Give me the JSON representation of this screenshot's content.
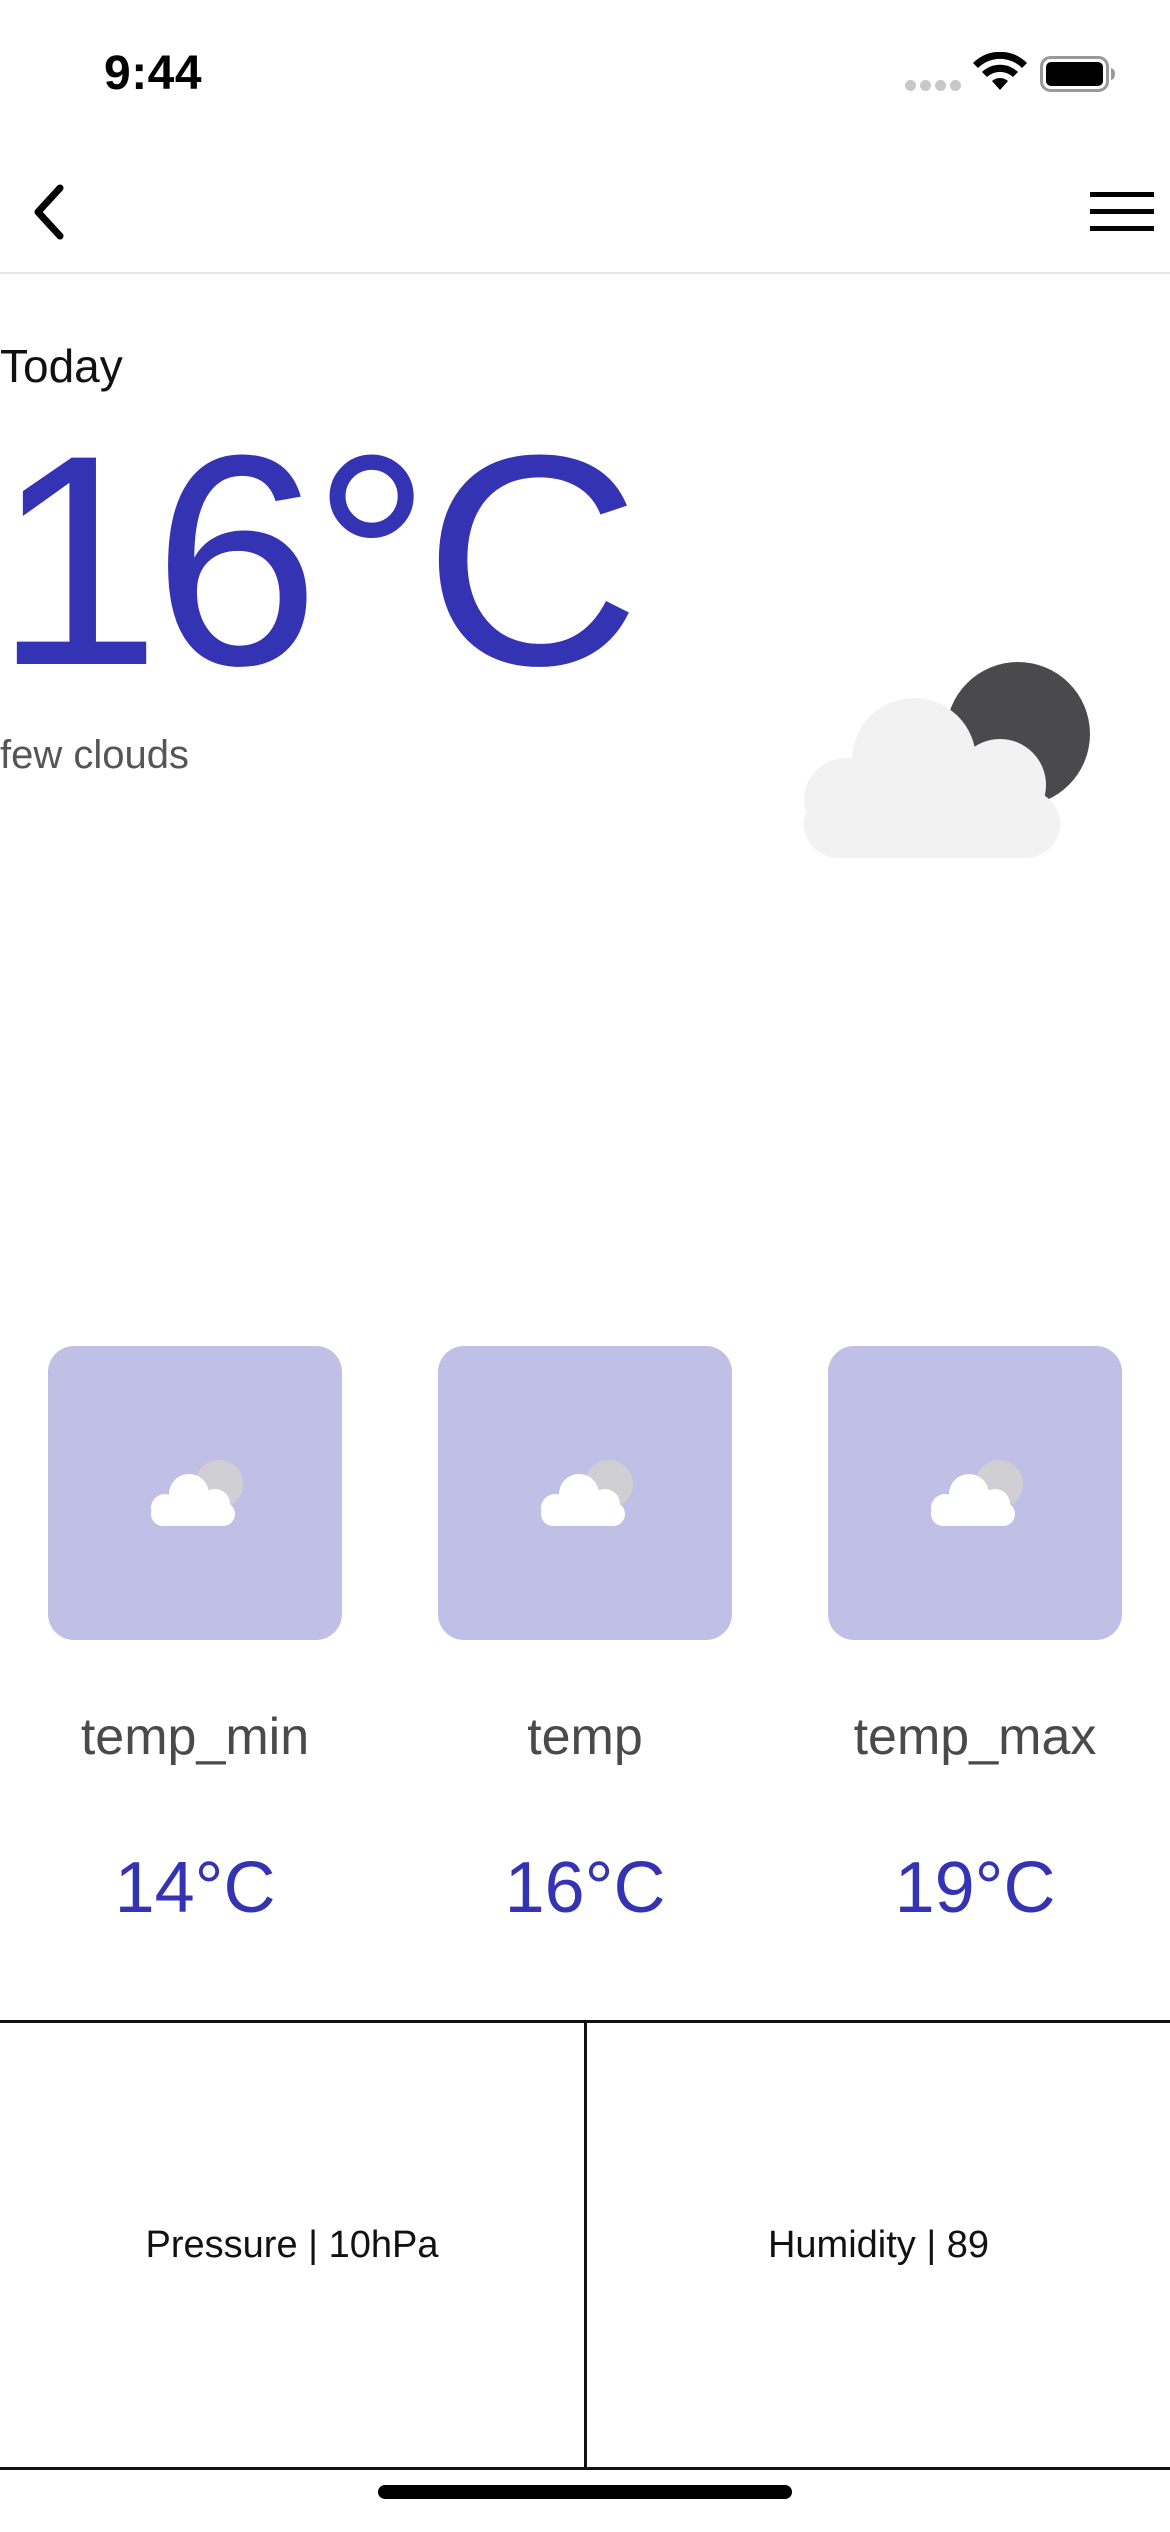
{
  "status_bar": {
    "time": "9:44",
    "icons": [
      "signal-icon",
      "wifi-icon",
      "battery-icon"
    ]
  },
  "nav": {
    "back_icon": "chevron-left-icon",
    "menu_icon": "hamburger-menu-icon"
  },
  "today": {
    "label": "Today",
    "temperature": "16°C",
    "description": "few clouds",
    "icon": "few-clouds-night-icon"
  },
  "cards": [
    {
      "label": "temp_min",
      "value": "14°C",
      "icon": "few-clouds-icon"
    },
    {
      "label": "temp",
      "value": "16°C",
      "icon": "few-clouds-icon"
    },
    {
      "label": "temp_max",
      "value": "19°C",
      "icon": "few-clouds-icon"
    }
  ],
  "info": {
    "pressure": "Pressure | 10hPa",
    "humidity": "Humidity | 89"
  },
  "colors": {
    "accent": "#3333b3",
    "card_bg": "#c0c0e6",
    "text_muted": "#4a4a4a"
  }
}
